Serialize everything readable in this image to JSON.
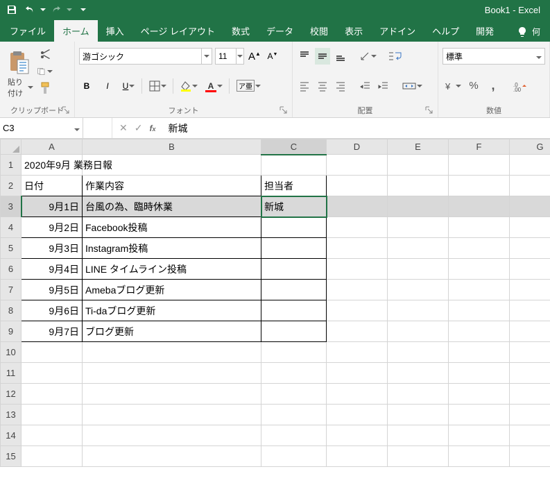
{
  "title": "Book1 - Excel",
  "tabs": {
    "file": "ファイル",
    "home": "ホーム",
    "insert": "挿入",
    "pagelayout": "ページ レイアウト",
    "formulas": "数式",
    "data": "データ",
    "review": "校閲",
    "view": "表示",
    "addins": "アドイン",
    "help": "ヘルプ",
    "developer": "開発"
  },
  "tellme_hint": "何",
  "ribbon": {
    "clipboard": {
      "paste": "貼り付け",
      "group": "クリップボード"
    },
    "font": {
      "name": "游ゴシック",
      "size": "11",
      "group": "フォント"
    },
    "alignment": {
      "group": "配置"
    },
    "number": {
      "format": "標準",
      "group": "数値"
    }
  },
  "namebox": "C3",
  "formula": "新城",
  "colheaders": [
    "A",
    "B",
    "C",
    "D",
    "E",
    "F",
    "G"
  ],
  "selected_col_index": 2,
  "rows": [
    {
      "n": 1,
      "a": "2020年9月 業務日報",
      "b": "",
      "c": "",
      "border": false,
      "a_overflow": true
    },
    {
      "n": 2,
      "a": "日付",
      "b": "作業内容",
      "c": "担当者",
      "border": true
    },
    {
      "n": 3,
      "a": "9月1日",
      "b": "台風の為、臨時休業",
      "c": "新城",
      "border": true,
      "selected": true,
      "a_right": true
    },
    {
      "n": 4,
      "a": "9月2日",
      "b": "Facebook投稿",
      "c": "",
      "border": true,
      "a_right": true
    },
    {
      "n": 5,
      "a": "9月3日",
      "b": "Instagram投稿",
      "c": "",
      "border": true,
      "a_right": true
    },
    {
      "n": 6,
      "a": "9月4日",
      "b": "LINE タイムライン投稿",
      "c": "",
      "border": true,
      "a_right": true
    },
    {
      "n": 7,
      "a": "9月5日",
      "b": "Amebaブログ更新",
      "c": "",
      "border": true,
      "a_right": true
    },
    {
      "n": 8,
      "a": "9月6日",
      "b": "Ti-daブログ更新",
      "c": "",
      "border": true,
      "a_right": true
    },
    {
      "n": 9,
      "a": "9月7日",
      "b": "ブログ更新",
      "c": "",
      "border": true,
      "a_right": true
    },
    {
      "n": 10,
      "a": "",
      "b": "",
      "c": "",
      "border": false
    },
    {
      "n": 11,
      "a": "",
      "b": "",
      "c": "",
      "border": false
    },
    {
      "n": 12,
      "a": "",
      "b": "",
      "c": "",
      "border": false
    },
    {
      "n": 13,
      "a": "",
      "b": "",
      "c": "",
      "border": false
    },
    {
      "n": 14,
      "a": "",
      "b": "",
      "c": "",
      "border": false
    },
    {
      "n": 15,
      "a": "",
      "b": "",
      "c": "",
      "border": false
    }
  ]
}
